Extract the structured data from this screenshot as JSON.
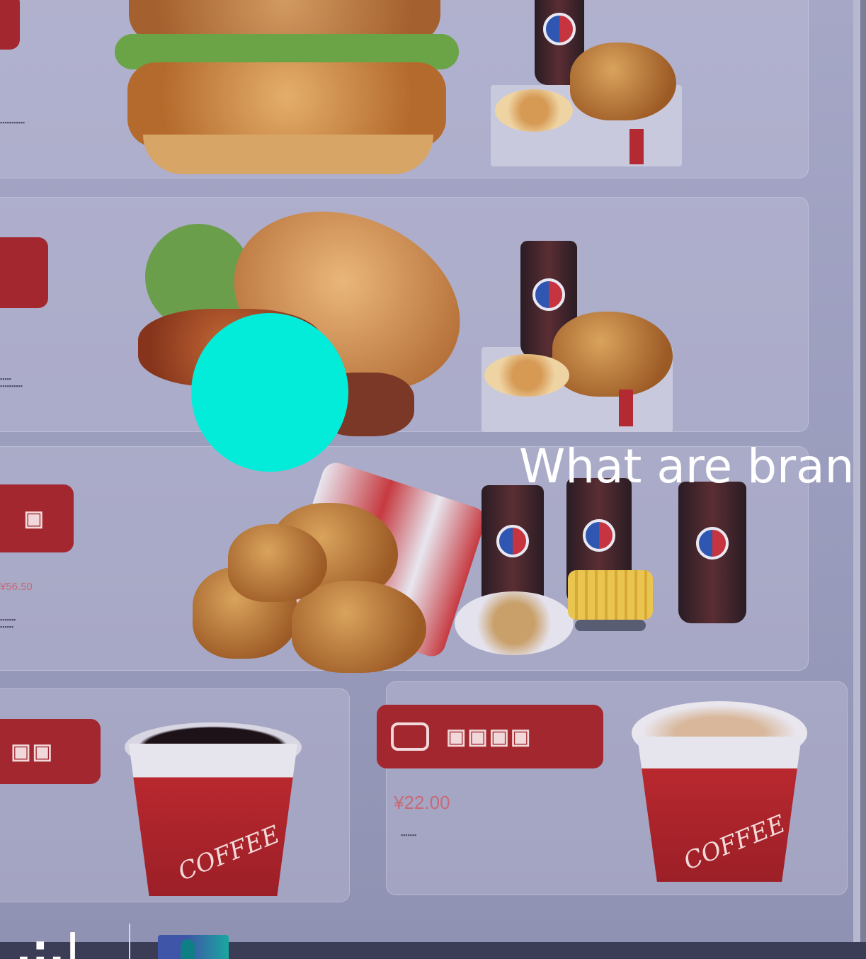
{
  "caption": "What are bran",
  "menu": {
    "prices": [
      "¥56.50",
      "¥22.00"
    ],
    "coffee_cup_text": "COFFEE"
  },
  "brand": {
    "text": "·"
  },
  "colors": {
    "accent_dot": "#03ecd9",
    "menu_tag_red": "#a2272f",
    "caption_text": "#ffffff"
  }
}
